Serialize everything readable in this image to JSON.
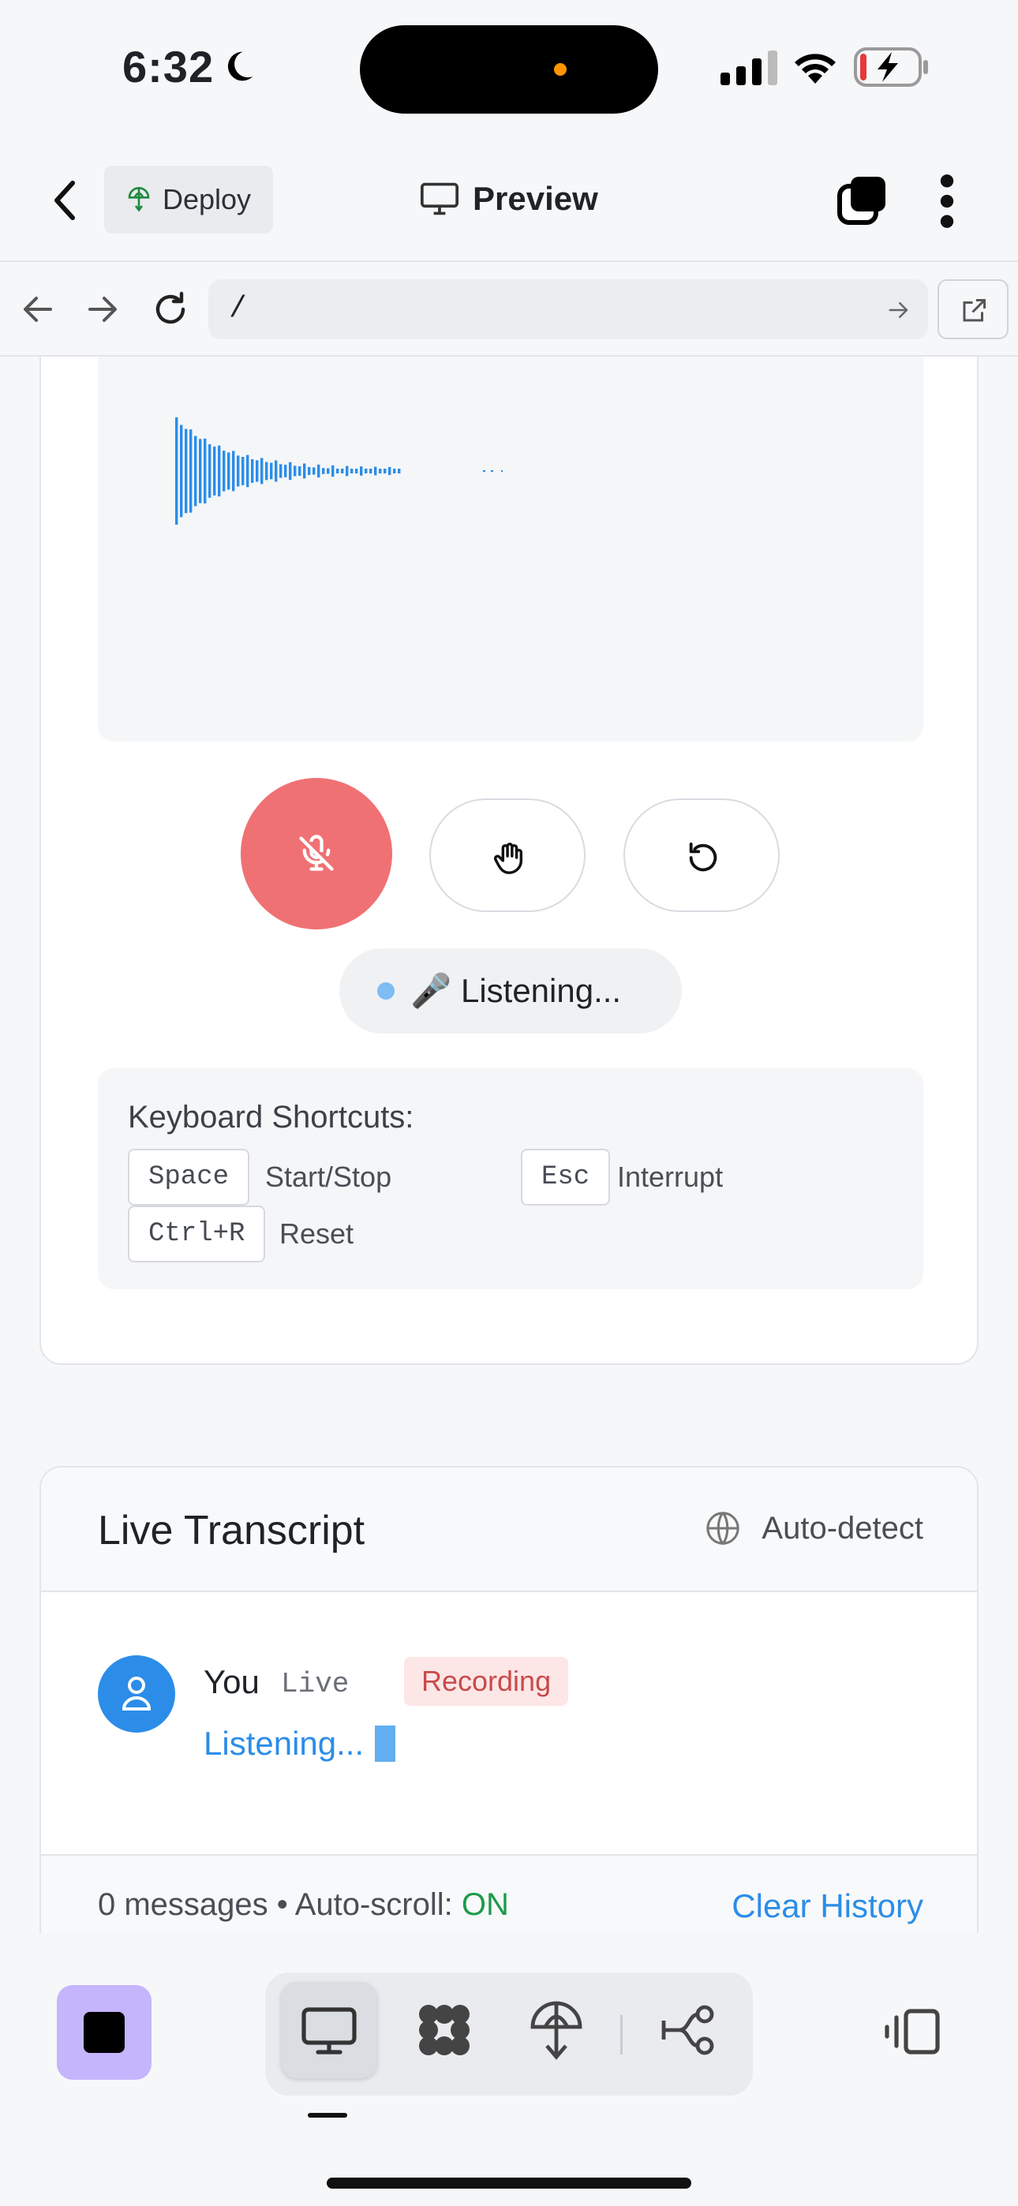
{
  "status_bar": {
    "time": "6:32"
  },
  "app_header": {
    "deploy_label": "Deploy",
    "title": "Preview"
  },
  "browser": {
    "url": "/"
  },
  "voice_panel": {
    "status_text": "🎤 Listening...",
    "shortcuts": {
      "title": "Keyboard Shortcuts:",
      "items": [
        {
          "key": "Space",
          "label": "Start/Stop"
        },
        {
          "key": "Esc",
          "label": "Interrupt"
        },
        {
          "key": "Ctrl+R",
          "label": "Reset"
        }
      ]
    }
  },
  "transcript": {
    "title": "Live Transcript",
    "language": "Auto-detect",
    "messages": [
      {
        "speaker": "You",
        "tag": "Live",
        "badge": "Recording",
        "text": "Listening..."
      }
    ],
    "footer": {
      "count_text": "0 messages • Auto-scroll: ",
      "autoscroll_value": "ON",
      "clear_label": "Clear History"
    }
  },
  "colors": {
    "accent_blue": "#2b8de8",
    "mic_active": "#f07173",
    "recording_badge": "#c94a4a",
    "autoscroll_on": "#1e9a4b",
    "stop_button_bg": "#c4b5fd"
  },
  "icons": {
    "status_bar": [
      "moon-icon",
      "cellular-signal-icon",
      "wifi-icon",
      "battery-charging-icon"
    ],
    "header": [
      "back-chevron-icon",
      "deploy-globe-icon",
      "monitor-icon",
      "tabs-icon",
      "more-vertical-icon"
    ],
    "browser": [
      "back-arrow-icon",
      "forward-arrow-icon",
      "reload-icon",
      "go-arrow-icon",
      "external-link-icon"
    ],
    "controls": [
      "mic-off-icon",
      "hand-icon",
      "reset-icon"
    ],
    "bottom": [
      "stop-icon",
      "monitor-icon",
      "puzzle-icon",
      "deploy-icon",
      "workflow-icon",
      "sidebar-toggle-icon"
    ]
  }
}
